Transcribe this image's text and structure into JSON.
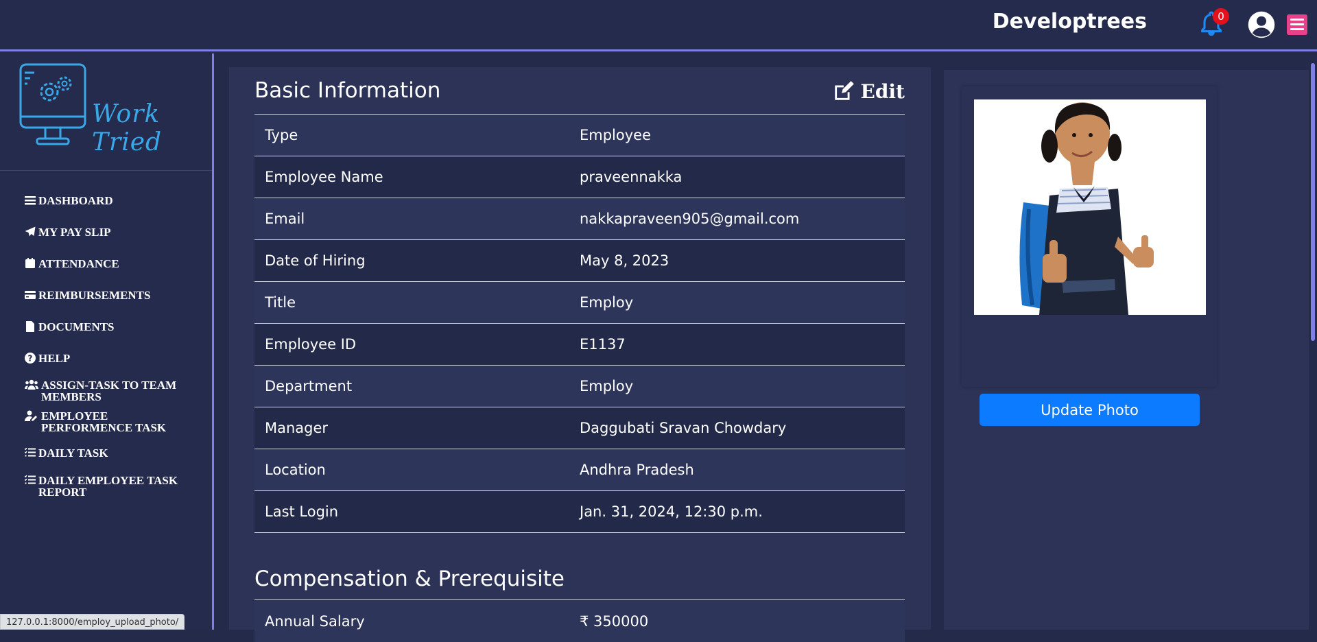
{
  "header": {
    "brand": "Developtrees",
    "notification_count": "0"
  },
  "sidebar": {
    "logo_text": "Work Tried",
    "items": [
      {
        "label": "DASHBOARD",
        "icon": "bars-icon"
      },
      {
        "label": "MY PAY SLIP",
        "icon": "paper-plane-icon"
      },
      {
        "label": "ATTENDANCE",
        "icon": "calendar-icon"
      },
      {
        "label": "REIMBURSEMENTS",
        "icon": "credit-card-icon"
      },
      {
        "label": "DOCUMENTS",
        "icon": "file-icon"
      },
      {
        "label": "HELP",
        "icon": "question-circle-icon"
      },
      {
        "label": "ASSIGN-TASK TO TEAM MEMBERS",
        "icon": "users-icon"
      },
      {
        "label": "EMPLOYEE PERFORMENCE TASK",
        "icon": "user-edit-icon"
      },
      {
        "label": "DAILY TASK",
        "icon": "list-check-icon"
      },
      {
        "label": "DAILY EMPLOYEE TASK REPORT",
        "icon": "list-check-icon"
      }
    ]
  },
  "basic_info": {
    "title": "Basic Information",
    "edit_label": "Edit",
    "rows": [
      {
        "label": "Type",
        "value": "Employee"
      },
      {
        "label": "Employee Name",
        "value": "praveennakka"
      },
      {
        "label": "Email",
        "value": "nakkapraveen905@gmail.com"
      },
      {
        "label": "Date of Hiring",
        "value": "May 8, 2023"
      },
      {
        "label": "Title",
        "value": "Employ"
      },
      {
        "label": "Employee ID",
        "value": "E1137"
      },
      {
        "label": "Department",
        "value": "Employ"
      },
      {
        "label": "Manager",
        "value": "Daggubati Sravan Chowdary"
      },
      {
        "label": "Location",
        "value": "Andhra Pradesh"
      },
      {
        "label": "Last Login",
        "value": "Jan. 31, 2024, 12:30 p.m."
      }
    ]
  },
  "compensation": {
    "title": "Compensation & Prerequisite",
    "rows": [
      {
        "label": "Annual Salary",
        "value": "₹  350000"
      }
    ]
  },
  "photo": {
    "update_label": "Update Photo"
  },
  "status_bar": {
    "url": "127.0.0.1:8000/employ_upload_photo/"
  },
  "colors": {
    "accent": "#7f7fe6",
    "primary_button": "#0d7bff",
    "badge": "#e4101c",
    "menu_button": "#e8408a",
    "logo": "#3aa8e8"
  }
}
